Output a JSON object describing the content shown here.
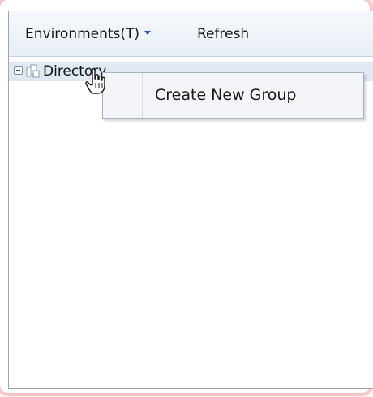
{
  "toolbar": {
    "environments_label": "Environments(T)",
    "refresh_label": "Refresh"
  },
  "tree": {
    "root_label": "Directory"
  },
  "context_menu": {
    "items": [
      {
        "label": "Create New Group"
      }
    ]
  },
  "icons": {
    "expander": "collapse-minus-icon",
    "folder": "directory-icon",
    "dropdown": "dropdown-arrow-icon",
    "cursor": "hand-pointer-cursor-icon"
  },
  "colors": {
    "toolbar_bg": "#e8eef6",
    "selected_row_bg": "#dfe8f3",
    "menu_bg": "#f3f5f8",
    "border": "#9aa7b5",
    "dropdown_arrow": "#1f5a9f"
  }
}
